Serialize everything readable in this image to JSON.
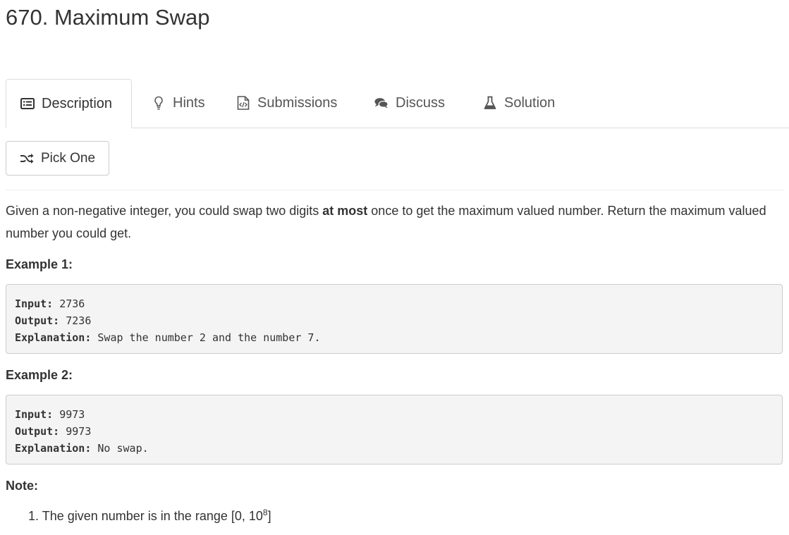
{
  "problem": {
    "title": "670. Maximum Swap"
  },
  "tabs": [
    {
      "label": "Description",
      "icon": "list-icon",
      "active": true
    },
    {
      "label": "Hints",
      "icon": "lightbulb-icon"
    },
    {
      "label": "Submissions",
      "icon": "code-file-icon"
    },
    {
      "label": "Discuss",
      "icon": "comments-icon"
    },
    {
      "label": "Solution",
      "icon": "flask-icon"
    }
  ],
  "pick_one": {
    "label": "Pick One",
    "icon": "shuffle-icon"
  },
  "description": {
    "intro_before": "Given a non-negative integer, you could swap two digits ",
    "intro_bold": "at most",
    "intro_after": " once to get the maximum valued number. Return the maximum valued number you could get."
  },
  "examples": [
    {
      "heading": "Example 1:",
      "input_label": "Input:",
      "input": " 2736",
      "output_label": "Output:",
      "output": " 7236",
      "explanation_label": "Explanation:",
      "explanation": " Swap the number 2 and the number 7."
    },
    {
      "heading": "Example 2:",
      "input_label": "Input:",
      "input": " 9973",
      "output_label": "Output:",
      "output": " 9973",
      "explanation_label": "Explanation:",
      "explanation": " No swap."
    }
  ],
  "note": {
    "heading": "Note:",
    "items": [
      {
        "number": "1.",
        "text": "The given number is in the range [0, 10",
        "sup": "8",
        "suffix": "]"
      }
    ]
  }
}
